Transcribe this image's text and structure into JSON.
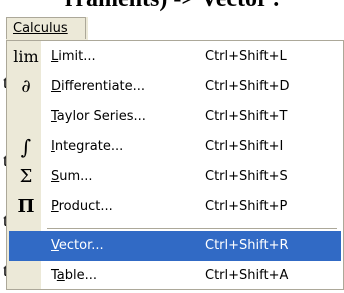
{
  "background": {
    "heading": "rraments) -> Vector .",
    "frags": [
      "t",
      "t",
      "t",
      "t"
    ]
  },
  "menubar": {
    "label": "Calculus",
    "accent": "#ece9d8"
  },
  "menu": {
    "selected_color": "#316ac5",
    "items": [
      {
        "icon": "lim",
        "label_pre": "",
        "label_u": "L",
        "label_post": "imit...",
        "shortcut": "Ctrl+Shift+L"
      },
      {
        "icon": "∂",
        "label_pre": "",
        "label_u": "D",
        "label_post": "ifferentiate...",
        "shortcut": "Ctrl+Shift+D"
      },
      {
        "icon": "",
        "label_pre": "",
        "label_u": "T",
        "label_post": "aylor Series...",
        "shortcut": "Ctrl+Shift+T"
      },
      {
        "icon": "∫",
        "label_pre": "",
        "label_u": "I",
        "label_post": "ntegrate...",
        "shortcut": "Ctrl+Shift+I"
      },
      {
        "icon": "Σ",
        "label_pre": "",
        "label_u": "S",
        "label_post": "um...",
        "shortcut": "Ctrl+Shift+S"
      },
      {
        "icon": "Π",
        "label_pre": "",
        "label_u": "P",
        "label_post": "roduct...",
        "shortcut": "Ctrl+Shift+P"
      },
      {
        "icon": "",
        "label_pre": "",
        "label_u": "V",
        "label_post": "ector...",
        "shortcut": "Ctrl+Shift+R"
      },
      {
        "icon": "",
        "label_pre": "T",
        "label_u": "a",
        "label_post": "ble...",
        "shortcut": "Ctrl+Shift+A"
      }
    ]
  }
}
